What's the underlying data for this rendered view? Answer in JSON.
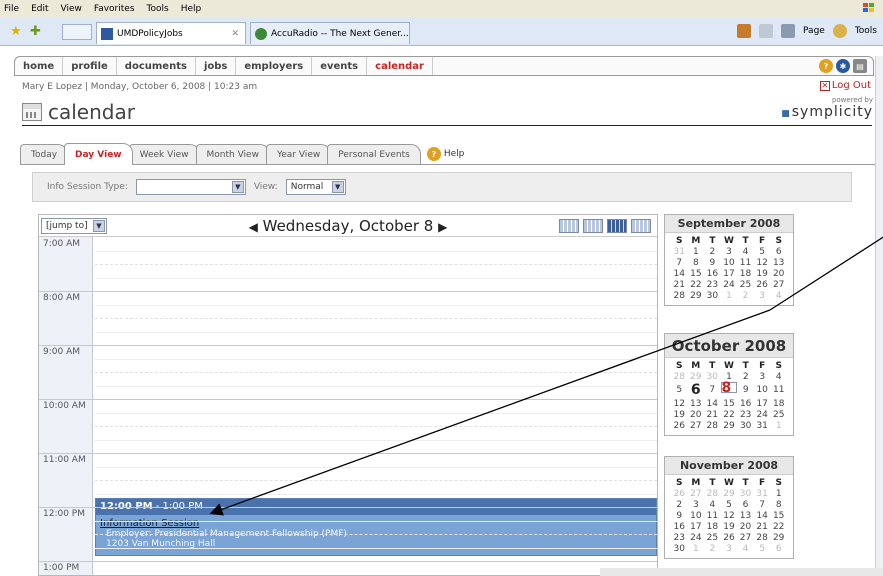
{
  "browser": {
    "menu": [
      "File",
      "Edit",
      "View",
      "Favorites",
      "Tools",
      "Help"
    ],
    "tabs": [
      {
        "label": "UMDPolicyJobs",
        "active": true
      },
      {
        "label": "AccuRadio -- The Next Gener...",
        "active": false
      }
    ],
    "tools": {
      "page": "Page",
      "tools": "Tools"
    }
  },
  "nav": {
    "items": [
      "home",
      "profile",
      "documents",
      "jobs",
      "employers",
      "events",
      "calendar"
    ],
    "active": "calendar"
  },
  "user_line": "Mary E Lopez | Monday, October 6, 2008 | 10:23 am",
  "logout": "Log Out",
  "powered_by": {
    "small": "powered by",
    "brand": "symplicity"
  },
  "page_title": "calendar",
  "view_tabs": [
    "Today",
    "Day View",
    "Week View",
    "Month View",
    "Year View",
    "Personal Events"
  ],
  "help_label": "Help",
  "filters": {
    "session_type_label": "Info Session Type:",
    "session_type_value": "",
    "view_label": "View:",
    "view_value": "Normal"
  },
  "day": {
    "jump": "[jump to]",
    "date": "Wednesday, October 8",
    "hours": [
      "7:00 AM",
      "8:00 AM",
      "9:00 AM",
      "10:00 AM",
      "11:00 AM",
      "12:00 PM",
      "1:00 PM"
    ]
  },
  "event": {
    "time": "12:00 PM",
    "time_end": " - 1:00 PM",
    "title": "Information Session",
    "employer": "Employer: Presidential Management Fellowship (PMF)",
    "location": "1203 Van Munching Hall"
  },
  "mini_calendars": [
    {
      "title": "September 2008",
      "weekdays": [
        "S",
        "M",
        "T",
        "W",
        "T",
        "F",
        "S"
      ],
      "weeks": [
        [
          "31",
          "1",
          "2",
          "3",
          "4",
          "5",
          "6"
        ],
        [
          "7",
          "8",
          "9",
          "10",
          "11",
          "12",
          "13"
        ],
        [
          "14",
          "15",
          "16",
          "17",
          "18",
          "19",
          "20"
        ],
        [
          "21",
          "22",
          "23",
          "24",
          "25",
          "26",
          "27"
        ],
        [
          "28",
          "29",
          "30",
          "1",
          "2",
          "3",
          "4"
        ]
      ]
    },
    {
      "title": "October 2008",
      "weekdays": [
        "S",
        "M",
        "T",
        "W",
        "T",
        "F",
        "S"
      ],
      "weeks": [
        [
          "28",
          "29",
          "30",
          "1",
          "2",
          "3",
          "4"
        ],
        [
          "5",
          "6",
          "7",
          "8",
          "9",
          "10",
          "11"
        ],
        [
          "12",
          "13",
          "14",
          "15",
          "16",
          "17",
          "18"
        ],
        [
          "19",
          "20",
          "21",
          "22",
          "23",
          "24",
          "25"
        ],
        [
          "26",
          "27",
          "28",
          "29",
          "30",
          "31",
          "1"
        ]
      ]
    },
    {
      "title": "November 2008",
      "weekdays": [
        "S",
        "M",
        "T",
        "W",
        "T",
        "F",
        "S"
      ],
      "weeks": [
        [
          "26",
          "27",
          "28",
          "29",
          "30",
          "31",
          "1"
        ],
        [
          "2",
          "3",
          "4",
          "5",
          "6",
          "7",
          "8"
        ],
        [
          "9",
          "10",
          "11",
          "12",
          "13",
          "14",
          "15"
        ],
        [
          "16",
          "17",
          "18",
          "19",
          "20",
          "21",
          "22"
        ],
        [
          "23",
          "24",
          "25",
          "26",
          "27",
          "28",
          "29"
        ],
        [
          "30",
          "1",
          "2",
          "3",
          "4",
          "5",
          "6"
        ]
      ]
    }
  ],
  "colors": {
    "accent_red": "#c22222",
    "event_blue": "#7aa3d6",
    "event_header": "#4a73ad"
  }
}
